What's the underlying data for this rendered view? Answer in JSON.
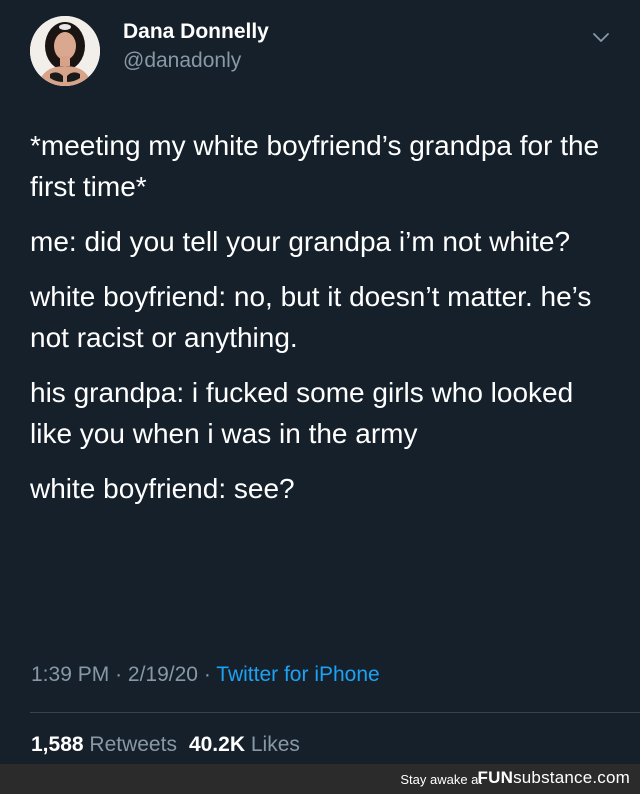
{
  "author": {
    "display_name": "Dana Donnelly",
    "handle": "@danadonly",
    "avatar_icon": "profile-photo"
  },
  "tweet": {
    "paragraphs": [
      "*meeting my white boyfriend’s grandpa for the first time*",
      "me: did you tell your grandpa i’m not white?",
      "white boyfriend: no, but it doesn’t matter. he’s not racist or anything.",
      "his grandpa: i fucked some girls who looked like you when i was in the army",
      "white boyfriend: see?"
    ]
  },
  "meta": {
    "time": "1:39 PM",
    "separator": "·",
    "date": "2/19/20",
    "source": "Twitter for iPhone"
  },
  "stats": {
    "retweets_count": "1,588",
    "retweets_label": "Retweets",
    "likes_count": "40.2K",
    "likes_label": "Likes"
  },
  "watermark": {
    "tagline": "Stay awake at",
    "brand_fun": "FUN",
    "brand_rest": "substance.com"
  },
  "colors": {
    "background": "#15202b",
    "primary_text": "#ffffff",
    "secondary_text": "#8899a6",
    "link": "#1da1f2",
    "footer_bg": "#2b2b2b"
  }
}
